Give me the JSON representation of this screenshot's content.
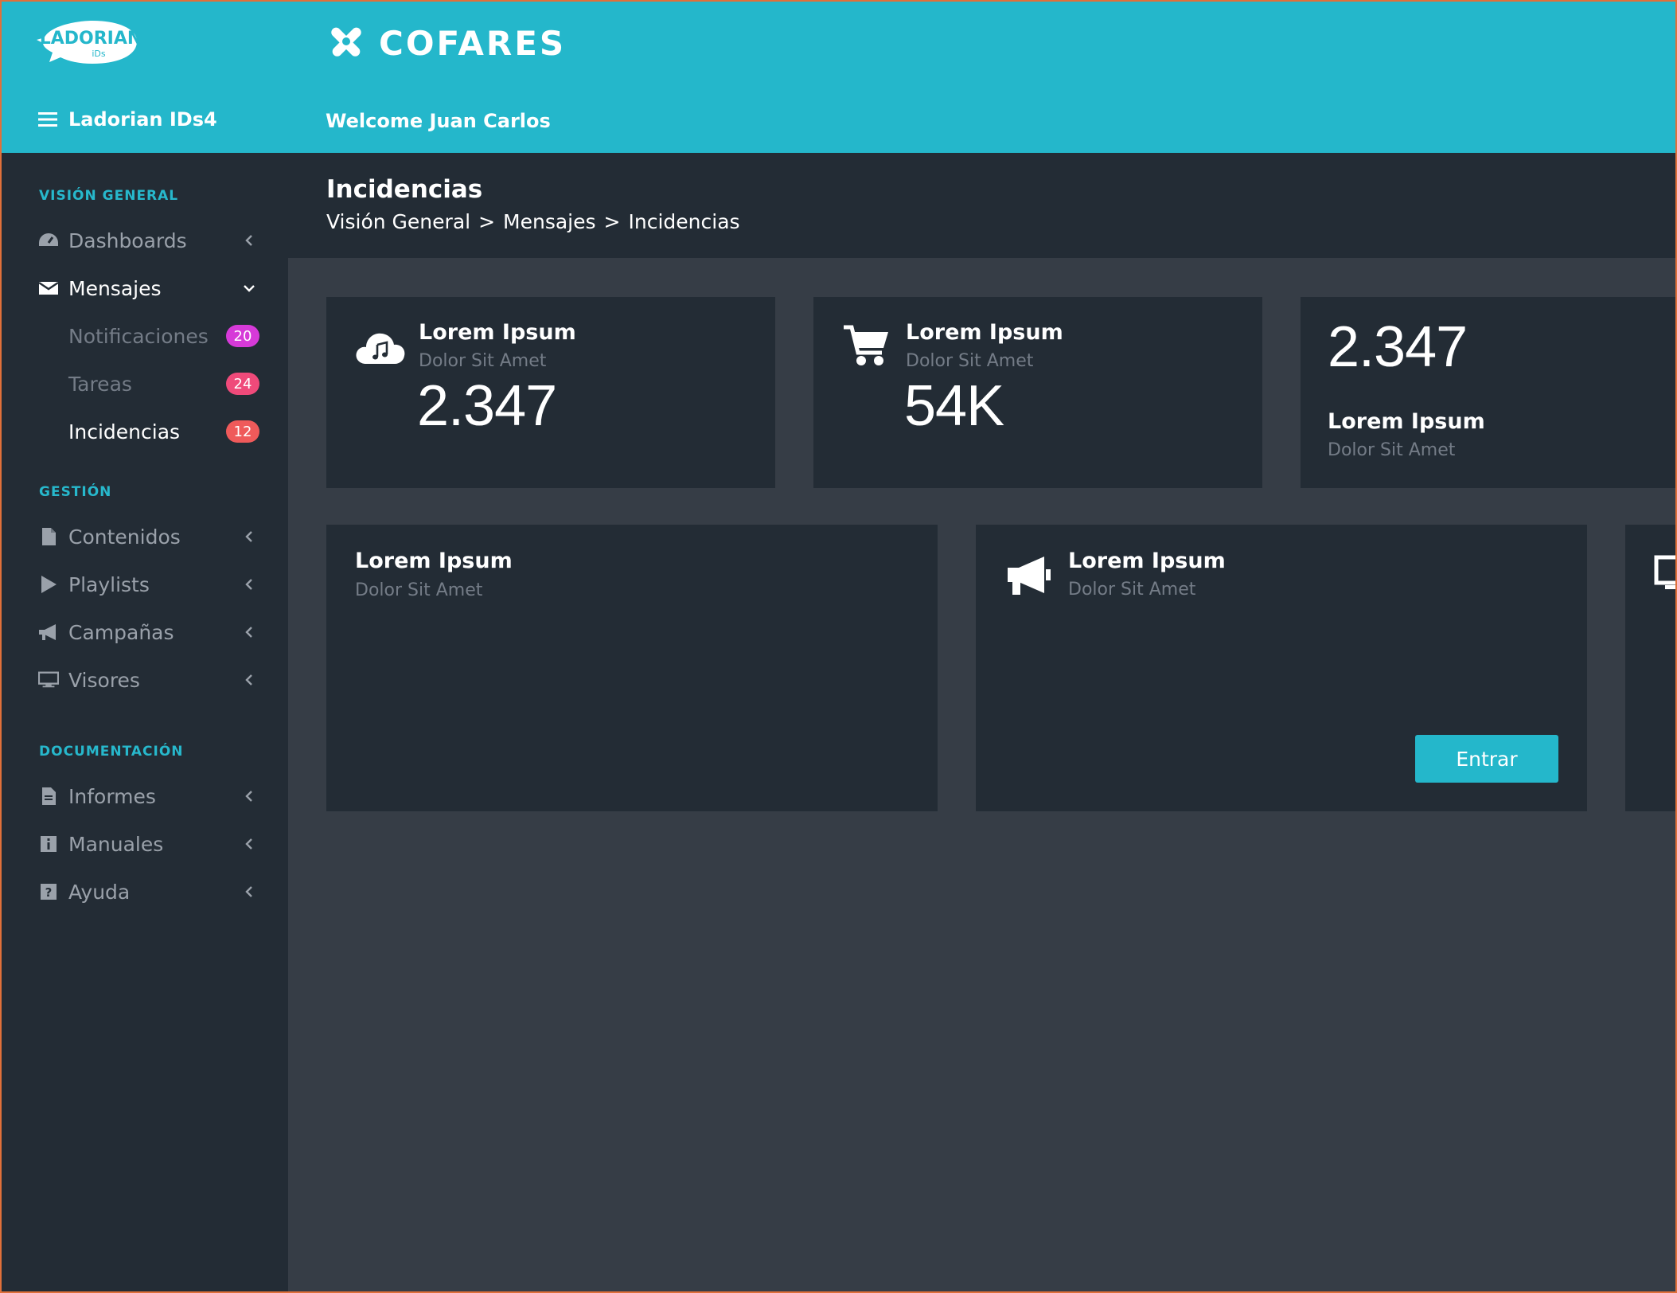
{
  "header": {
    "logo_text": "LADORIAN",
    "logo_subtext": "iDs",
    "brand": "COFARES",
    "app_name": "Ladorian IDs4",
    "welcome": "Welcome Juan Carlos",
    "colors": {
      "header_bg": "#24b7cb",
      "sidebar_bg": "#232c35",
      "content_bg": "#363d46",
      "accent": "#24b7cb"
    }
  },
  "sidebar": {
    "sections": [
      {
        "title": "VISIÓN GENERAL"
      },
      {
        "title": "GESTIÓN"
      },
      {
        "title": "DOCUMENTACIÓN"
      }
    ],
    "items": [
      {
        "label": "Dashboards",
        "icon": "dashboard-icon"
      },
      {
        "label": "Mensajes",
        "icon": "envelope-icon",
        "expanded": true
      },
      {
        "label": "Contenidos",
        "icon": "file-icon"
      },
      {
        "label": "Playlists",
        "icon": "play-icon"
      },
      {
        "label": "Campañas",
        "icon": "megaphone-icon"
      },
      {
        "label": "Visores",
        "icon": "monitor-icon"
      },
      {
        "label": "Informes",
        "icon": "document-icon"
      },
      {
        "label": "Manuales",
        "icon": "info-icon"
      },
      {
        "label": "Ayuda",
        "icon": "help-icon"
      }
    ],
    "subitems": [
      {
        "label": "Notificaciones",
        "badge": "20",
        "badge_color": "#d63ad8"
      },
      {
        "label": "Tareas",
        "badge": "24",
        "badge_color": "#ef4a7a"
      },
      {
        "label": "Incidencias",
        "badge": "12",
        "badge_color": "#ef5a5a",
        "current": true
      }
    ]
  },
  "page": {
    "title": "Incidencias",
    "breadcrumb": [
      "Visión General",
      ">",
      "Mensajes",
      ">",
      "Incidencias"
    ]
  },
  "cards": [
    {
      "title": "Lorem Ipsum",
      "subtitle": "Dolor Sit Amet",
      "value": "2.347",
      "icon": "cloud-music-icon"
    },
    {
      "title": "Lorem Ipsum",
      "subtitle": "Dolor Sit Amet",
      "value": "54K",
      "icon": "cart-icon"
    },
    {
      "title": "Lorem Ipsum",
      "subtitle": "Dolor Sit Amet",
      "value": "2.347"
    },
    {
      "title": "Lorem Ipsum",
      "subtitle": "Dolor Sit Amet"
    },
    {
      "title": "Lorem Ipsum",
      "subtitle": "Dolor Sit Amet",
      "icon": "megaphone-icon",
      "button": "Entrar"
    },
    {
      "icon": "monitor-icon"
    }
  ]
}
